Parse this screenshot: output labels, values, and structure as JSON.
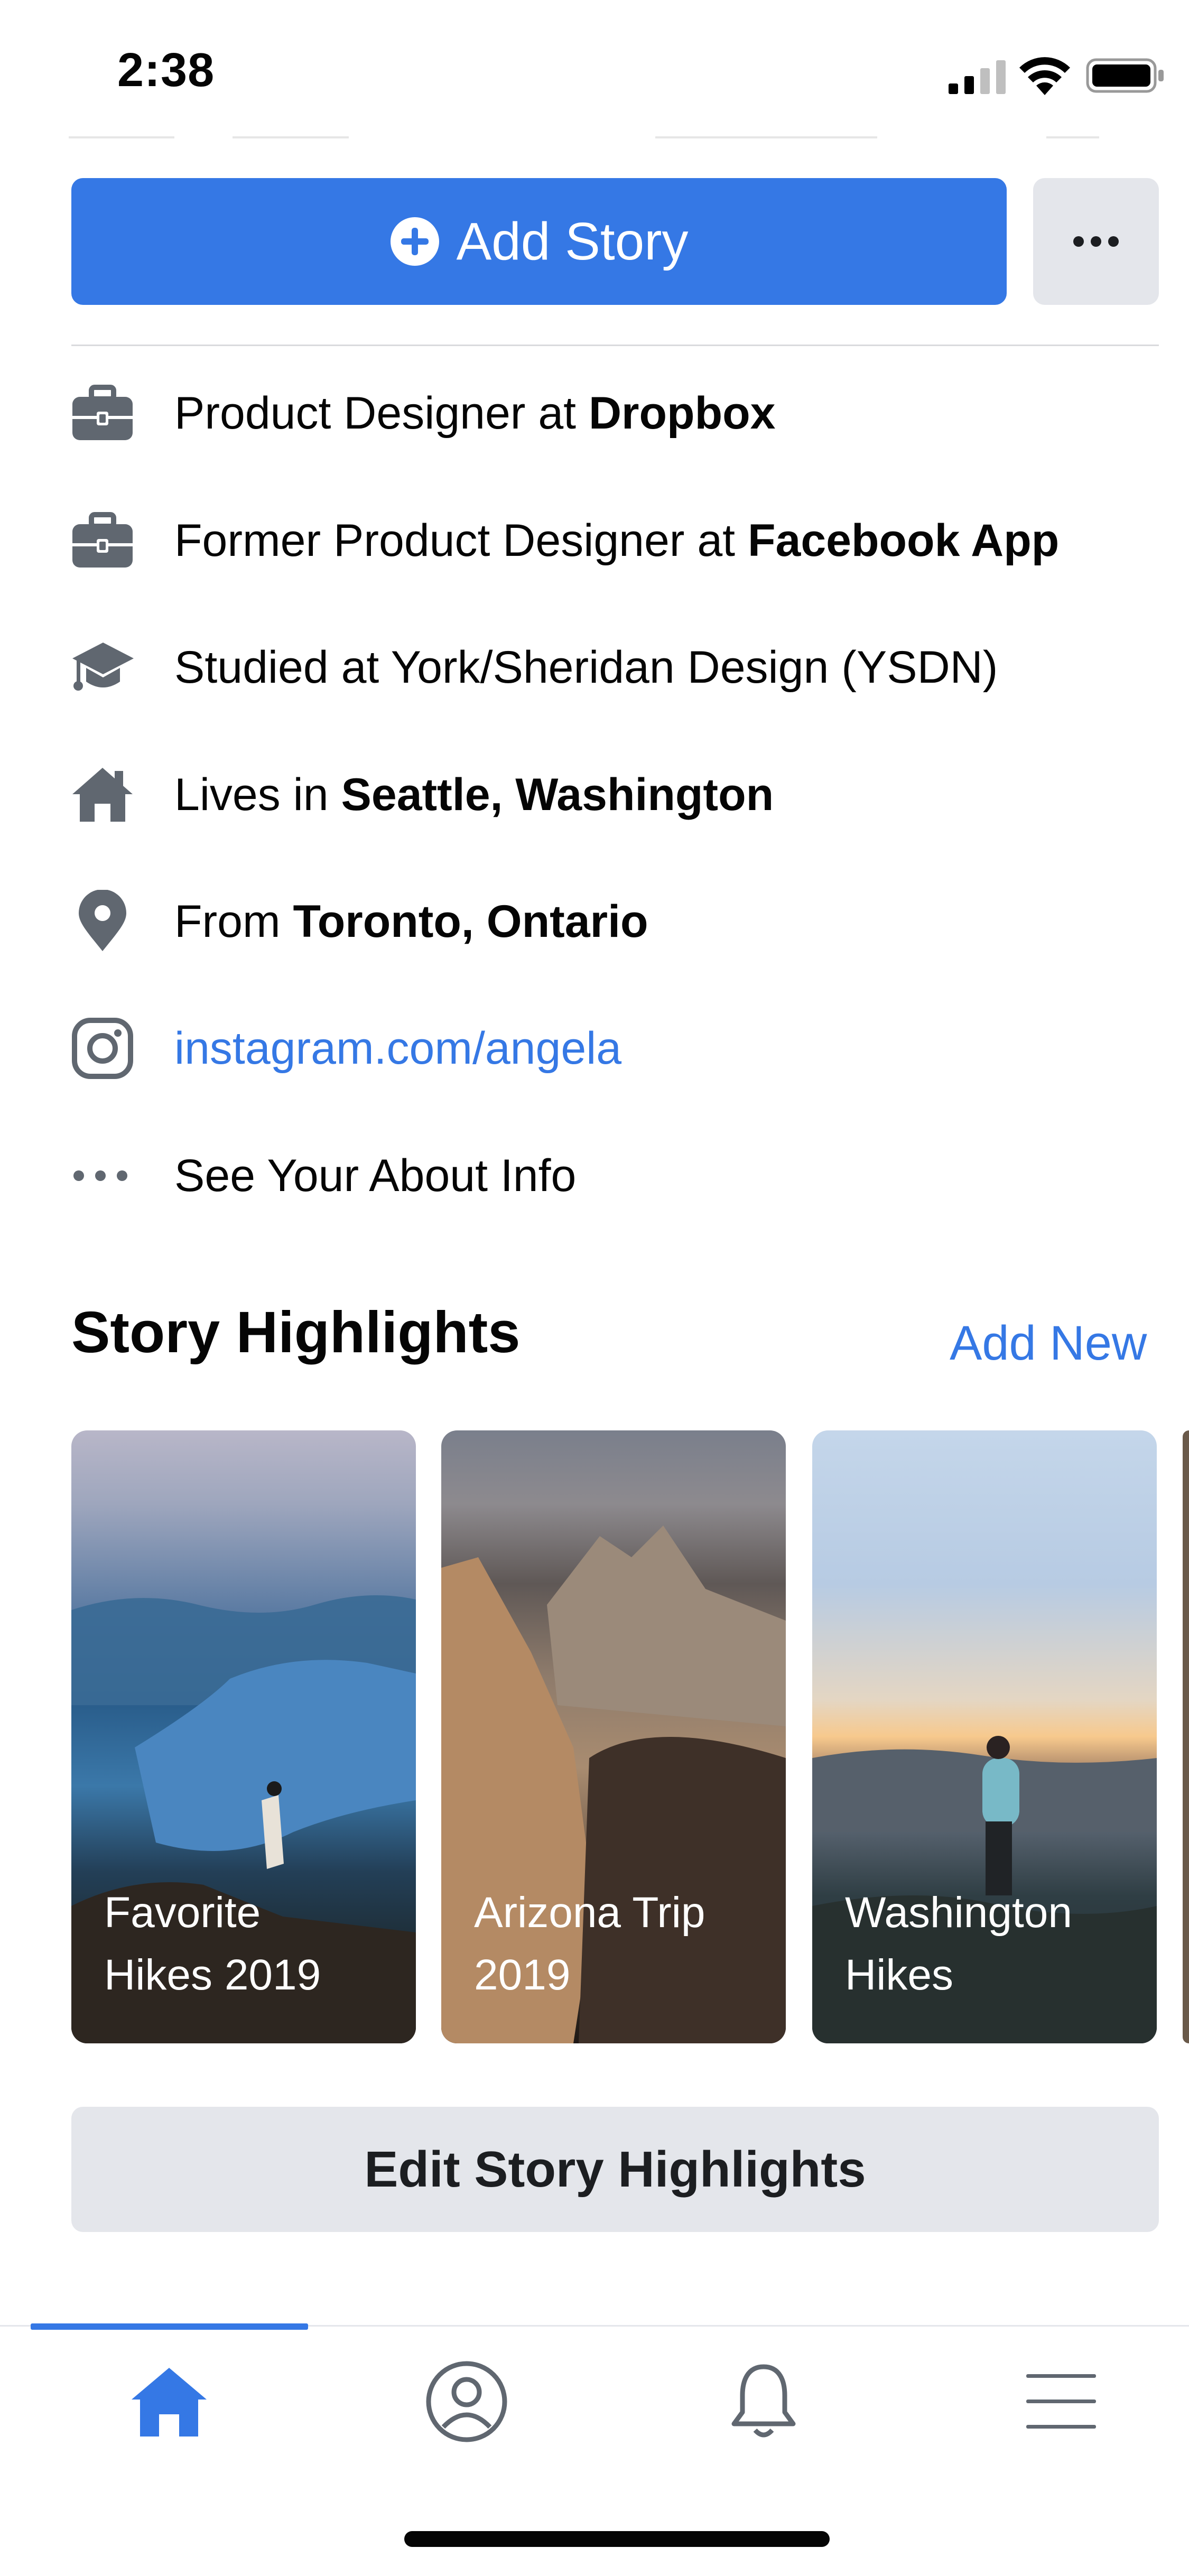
{
  "status_bar": {
    "time": "2:38"
  },
  "actions": {
    "add_story_label": "Add Story"
  },
  "info": [
    {
      "icon": "briefcase-icon",
      "prefix": "Product Designer at ",
      "bold": "Dropbox"
    },
    {
      "icon": "briefcase-icon",
      "prefix": "Former Product Designer at ",
      "bold": "Facebook App"
    },
    {
      "icon": "graduation-cap-icon",
      "prefix": "Studied at York/Sheridan Design (YSDN)",
      "bold": ""
    },
    {
      "icon": "house-icon",
      "prefix": "Lives in ",
      "bold": "Seattle, Washington"
    },
    {
      "icon": "location-pin-icon",
      "prefix": "From ",
      "bold": "Toronto, Ontario"
    },
    {
      "icon": "instagram-icon",
      "prefix": "instagram.com/angela",
      "bold": ""
    },
    {
      "icon": "ellipsis-icon",
      "prefix": "See Your About Info",
      "bold": ""
    }
  ],
  "highlights": {
    "title": "Story Highlights",
    "add_new": "Add New",
    "cards": [
      {
        "line1": "Favorite",
        "line2": "Hikes 2019"
      },
      {
        "line1": "Arizona Trip",
        "line2": "2019"
      },
      {
        "line1": "Washington",
        "line2": "Hikes"
      }
    ],
    "edit_label": "Edit Story Highlights"
  },
  "tabbar": {
    "tabs": [
      "home-icon",
      "profile-icon",
      "bell-icon",
      "menu-icon"
    ],
    "active": "home"
  },
  "colors": {
    "accent": "#3578e5",
    "button_gray": "#e4e6eb",
    "icon_gray": "#606770"
  }
}
